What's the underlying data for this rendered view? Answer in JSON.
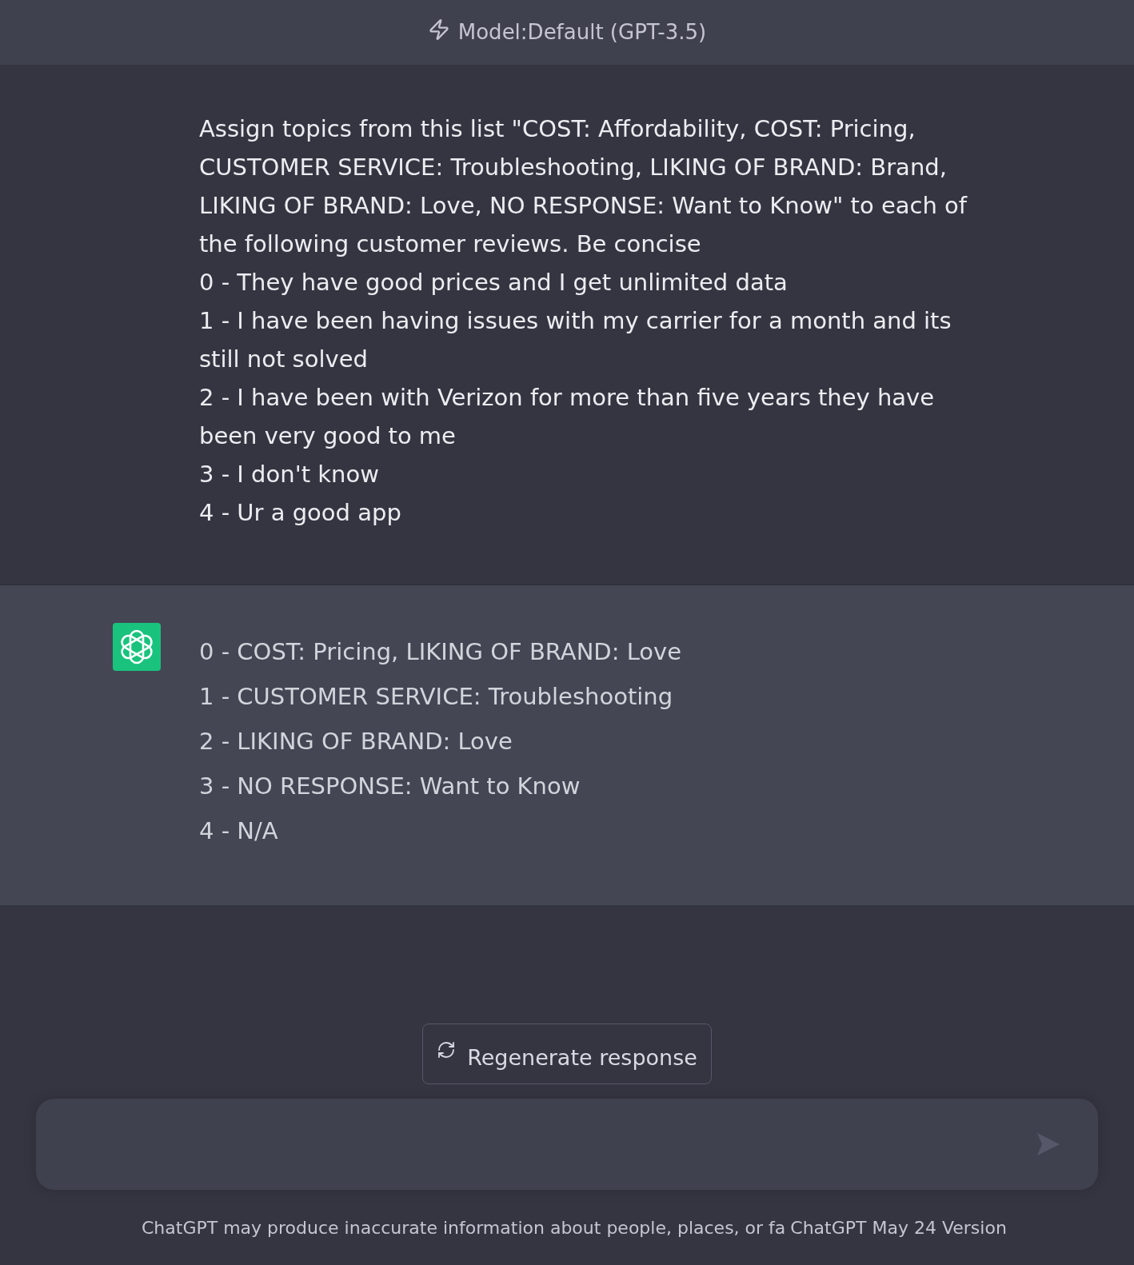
{
  "header": {
    "title": "Model:Default (GPT-3.5)"
  },
  "messages": [
    {
      "kind": "user",
      "lines": [
        "Assign topics from this list \"COST: Affordability, COST: Pricing, CUSTOMER SERVICE: Troubleshooting, LIKING OF BRAND: Brand, LIKING OF BRAND: Love, NO RESPONSE: Want to Know\" to each of the following customer reviews. Be concise",
        "0 - They have good prices and I get unlimited data",
        "1 - I have been having issues with my carrier for a month and its still not solved",
        "2 - I have been with Verizon for more than five years they have been very good to me",
        "3 - I don't know",
        "4 - Ur a good app"
      ]
    },
    {
      "kind": "assistant",
      "lines": [
        "0 - COST: Pricing, LIKING OF BRAND: Love",
        "1 - CUSTOMER SERVICE: Troubleshooting",
        "2 - LIKING OF BRAND: Love",
        "3 - NO RESPONSE: Want to Know",
        "4 - N/A"
      ]
    }
  ],
  "regenerate_button": {
    "label": "Regenerate response"
  },
  "footer": {
    "disclaimer": "ChatGPT may produce inaccurate information about people, places, or fa",
    "version": "ChatGPT May 24 Version"
  }
}
